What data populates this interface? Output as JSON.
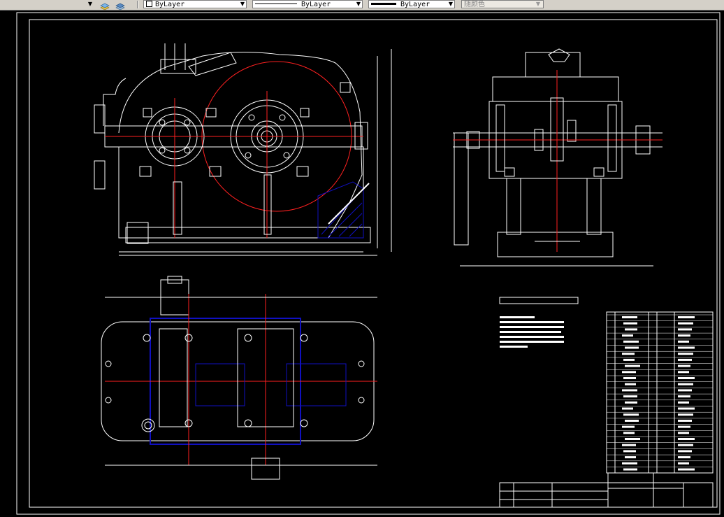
{
  "toolbar": {
    "layer_icon_1": "layer-states-icon",
    "layer_icon_2": "layer-previous-icon",
    "color_dropdown": "ByLayer",
    "linetype_dropdown": "ByLayer",
    "lineweight_dropdown": "ByLayer",
    "plotstyle_dropdown": "随颜色"
  },
  "colors": {
    "background": "#000000",
    "line": "#ffffff",
    "center": "#ff0000",
    "hatch": "#1010c0",
    "toolbar": "#d4d0c8"
  }
}
